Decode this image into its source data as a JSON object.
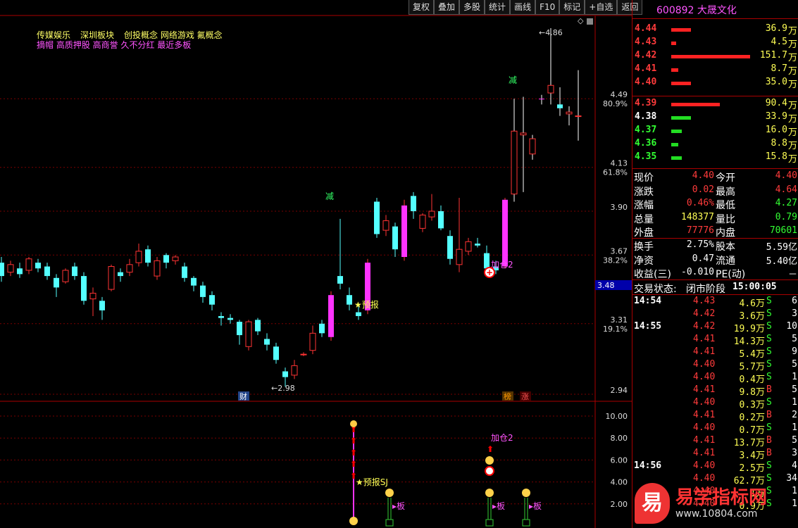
{
  "toolbar": [
    "复权",
    "叠加",
    "多股",
    "统计",
    "画线",
    "F10",
    "标记",
    "+自选",
    "返回"
  ],
  "chart": {
    "tags_line1": [
      "传媒娱乐",
      "深圳板块",
      "创投概念 网络游戏 氟概念"
    ],
    "tags_line2": [
      "摘帽 高质押股 高商誉 久不分红 最近多板"
    ],
    "price_axis": [
      "4.49",
      "80.9%",
      "4.13",
      "61.8%",
      "3.90",
      "3.67",
      "38.2%",
      "3.31",
      "19.1%",
      "2.94"
    ],
    "current_price_tag": "3.48",
    "high_label": "4.86",
    "low_label": "2.98",
    "annotations": {
      "jian1": "减",
      "jian2": "减",
      "yubao": "★预报",
      "jiacang": "加仓2",
      "cai": "财",
      "bang": "榜",
      "zhang": "涨"
    },
    "sub_axis": [
      "10.00",
      "8.00",
      "6.00",
      "4.00",
      "2.00"
    ],
    "sub_annotations": {
      "jiacang": "加仓2",
      "yubao": "★预报SJ",
      "ban1": "▸板",
      "ban2": "▸板",
      "ban3": "▸板"
    }
  },
  "chart_data": {
    "type": "candlestick",
    "ylim": [
      2.94,
      4.86
    ],
    "candles": [
      [
        3.63,
        3.56,
        3.66,
        3.53
      ],
      [
        3.58,
        3.62,
        3.64,
        3.56
      ],
      [
        3.6,
        3.57,
        3.63,
        3.55
      ],
      [
        3.59,
        3.65,
        3.66,
        3.57
      ],
      [
        3.63,
        3.6,
        3.65,
        3.58
      ],
      [
        3.61,
        3.56,
        3.63,
        3.54
      ],
      [
        3.55,
        3.5,
        3.57,
        3.45
      ],
      [
        3.53,
        3.59,
        3.6,
        3.52
      ],
      [
        3.61,
        3.56,
        3.63,
        3.54
      ],
      [
        3.56,
        3.43,
        3.58,
        3.41
      ],
      [
        3.44,
        3.47,
        3.5,
        3.35
      ],
      [
        3.43,
        3.38,
        3.45,
        3.33
      ],
      [
        3.49,
        3.61,
        3.62,
        3.48
      ],
      [
        3.58,
        3.56,
        3.6,
        3.53
      ],
      [
        3.58,
        3.62,
        3.65,
        3.56
      ],
      [
        3.63,
        3.69,
        3.73,
        3.61
      ],
      [
        3.7,
        3.63,
        3.72,
        3.61
      ],
      [
        3.56,
        3.64,
        3.66,
        3.54
      ],
      [
        3.67,
        3.63,
        3.68,
        3.6
      ],
      [
        3.64,
        3.66,
        3.67,
        3.62
      ],
      [
        3.61,
        3.55,
        3.63,
        3.53
      ],
      [
        3.55,
        3.51,
        3.56,
        3.48
      ],
      [
        3.51,
        3.45,
        3.53,
        3.42
      ],
      [
        3.46,
        3.41,
        3.48,
        3.38
      ],
      [
        3.35,
        3.34,
        3.37,
        3.3
      ],
      [
        3.34,
        3.33,
        3.36,
        3.31
      ],
      [
        3.32,
        3.25,
        3.33,
        3.2
      ],
      [
        3.19,
        3.32,
        3.33,
        3.17
      ],
      [
        3.33,
        3.27,
        3.34,
        3.25
      ],
      [
        3.23,
        3.2,
        3.26,
        3.17
      ],
      [
        3.19,
        3.12,
        3.21,
        3.1
      ],
      [
        3.06,
        3.03,
        3.08,
        2.98
      ],
      [
        3.04,
        3.09,
        3.12,
        3.02
      ],
      [
        3.15,
        3.15,
        3.16,
        3.14
      ],
      [
        3.17,
        3.26,
        3.3,
        3.15
      ],
      [
        3.31,
        3.26,
        3.33,
        3.24
      ],
      [
        3.24,
        3.46,
        3.48,
        3.22
      ],
      [
        3.56,
        3.52,
        3.86,
        3.49
      ],
      [
        3.46,
        3.41,
        3.5,
        3.38
      ],
      [
        3.37,
        3.35,
        3.4,
        3.33
      ],
      [
        3.38,
        3.63,
        3.65,
        3.36
      ],
      [
        3.95,
        3.78,
        3.97,
        3.76
      ],
      [
        3.8,
        3.85,
        3.88,
        3.77
      ],
      [
        3.82,
        3.7,
        3.84,
        3.66
      ],
      [
        3.66,
        3.93,
        3.96,
        3.64
      ],
      [
        3.98,
        3.9,
        4.0,
        3.86
      ],
      [
        3.81,
        3.88,
        3.89,
        3.79
      ],
      [
        3.87,
        3.9,
        3.99,
        3.85
      ],
      [
        3.9,
        3.81,
        3.93,
        3.8
      ],
      [
        3.77,
        3.65,
        3.8,
        3.62
      ],
      [
        3.62,
        3.7,
        3.97,
        3.58
      ],
      [
        3.69,
        3.74,
        3.76,
        3.67
      ],
      [
        3.73,
        3.72,
        3.76,
        3.71
      ],
      [
        3.68,
        3.6,
        3.72,
        3.58
      ],
      [
        3.61,
        3.59,
        3.64,
        3.57
      ],
      [
        3.61,
        3.96,
        3.97,
        3.6
      ],
      [
        3.99,
        4.32,
        4.49,
        3.95
      ],
      [
        4.3,
        4.31,
        4.5,
        4.0
      ],
      [
        4.2,
        4.28,
        4.3,
        4.17
      ],
      [
        4.49,
        4.49,
        4.51,
        4.46
      ],
      [
        4.52,
        4.56,
        4.86,
        4.46
      ],
      [
        4.46,
        4.44,
        4.55,
        4.4
      ],
      [
        4.41,
        4.42,
        4.45,
        4.35
      ],
      [
        4.4,
        4.4,
        4.64,
        4.27
      ]
    ],
    "ohlc_order": [
      "open",
      "close",
      "high",
      "low"
    ]
  },
  "panel": {
    "code": "600892",
    "name": "大晟文化",
    "asks": [
      {
        "p": "4.44",
        "v": "36.9",
        "bar": 0.22
      },
      {
        "p": "4.43",
        "v": "4.5",
        "bar": 0.03
      },
      {
        "p": "4.42",
        "v": "151.7",
        "bar": 1.0
      },
      {
        "p": "4.41",
        "v": "8.7",
        "bar": 0.06
      },
      {
        "p": "4.40",
        "v": "35.0",
        "bar": 0.22
      }
    ],
    "bids": [
      {
        "p": "4.39",
        "v": "90.4",
        "bar": 0.6,
        "c": "red"
      },
      {
        "p": "4.38",
        "v": "33.9",
        "bar": 0.22,
        "c": "white"
      },
      {
        "p": "4.37",
        "v": "16.0",
        "bar": 0.1,
        "c": "green"
      },
      {
        "p": "4.36",
        "v": "8.8",
        "bar": 0.06,
        "c": "green"
      },
      {
        "p": "4.35",
        "v": "15.8",
        "bar": 0.1,
        "c": "green"
      }
    ],
    "wan": "万",
    "stats": [
      [
        "现价",
        "4.40",
        "red",
        "今开",
        "4.40",
        "red"
      ],
      [
        "涨跌",
        "0.02",
        "red",
        "最高",
        "4.64",
        "red"
      ],
      [
        "涨幅",
        "0.46%",
        "red",
        "最低",
        "4.27",
        "green"
      ],
      [
        "总量",
        "148377",
        "yellow",
        "量比",
        "0.79",
        "green"
      ],
      [
        "外盘",
        "77776",
        "red",
        "内盘",
        "70601",
        "green"
      ]
    ],
    "stats2": [
      [
        "换手",
        "2.75%",
        "white",
        "股本",
        "5.59亿",
        "white"
      ],
      [
        "净资",
        "0.47",
        "white",
        "流通",
        "5.40亿",
        "white"
      ],
      [
        "收益(三)",
        "-0.010",
        "white",
        "PE(动)",
        "－",
        "white"
      ]
    ],
    "status_label": "交易状态:",
    "status_value": "闭市阶段",
    "status_time": "15:00:05",
    "ticks": [
      {
        "t": "14:54",
        "p": "4.43",
        "v": "4.6万",
        "s": "S",
        "n": "6",
        "pc": "red"
      },
      {
        "t": "",
        "p": "4.42",
        "v": "3.6万",
        "s": "S",
        "n": "3",
        "pc": "red"
      },
      {
        "t": "14:55",
        "p": "4.42",
        "v": "19.9万",
        "s": "S",
        "n": "10",
        "pc": "red"
      },
      {
        "t": "",
        "p": "4.41",
        "v": "14.3万",
        "s": "S",
        "n": "5",
        "pc": "red"
      },
      {
        "t": "",
        "p": "4.41",
        "v": "5.4万",
        "s": "S",
        "n": "9",
        "pc": "red"
      },
      {
        "t": "",
        "p": "4.40",
        "v": "5.7万",
        "s": "S",
        "n": "5",
        "pc": "red"
      },
      {
        "t": "",
        "p": "4.40",
        "v": "0.4万",
        "s": "S",
        "n": "1",
        "pc": "red"
      },
      {
        "t": "",
        "p": "4.41",
        "v": "9.8万",
        "s": "B",
        "n": "5",
        "pc": "red"
      },
      {
        "t": "",
        "p": "4.40",
        "v": "0.3万",
        "s": "S",
        "n": "1",
        "pc": "red"
      },
      {
        "t": "",
        "p": "4.41",
        "v": "0.2万",
        "s": "B",
        "n": "2",
        "pc": "red"
      },
      {
        "t": "",
        "p": "4.40",
        "v": "0.7万",
        "s": "S",
        "n": "1",
        "pc": "red"
      },
      {
        "t": "",
        "p": "4.41",
        "v": "13.7万",
        "s": "B",
        "n": "5",
        "pc": "red"
      },
      {
        "t": "",
        "p": "4.41",
        "v": "3.4万",
        "s": "B",
        "n": "3",
        "pc": "red"
      },
      {
        "t": "14:56",
        "p": "4.40",
        "v": "2.5万",
        "s": "S",
        "n": "4",
        "pc": "red"
      },
      {
        "t": "",
        "p": "4.40",
        "v": "62.7万",
        "s": "S",
        "n": "34",
        "pc": "red"
      },
      {
        "t": "",
        "p": "4.40",
        "v": "1万",
        "s": "S",
        "n": "1",
        "pc": "red"
      },
      {
        "t": "",
        "p": "4.40",
        "v": "0.9万",
        "s": "S",
        "n": "1",
        "pc": "red"
      }
    ],
    "watermark_logo": "易",
    "watermark_text": "易学指标网",
    "watermark_url": "www.10804.com"
  }
}
